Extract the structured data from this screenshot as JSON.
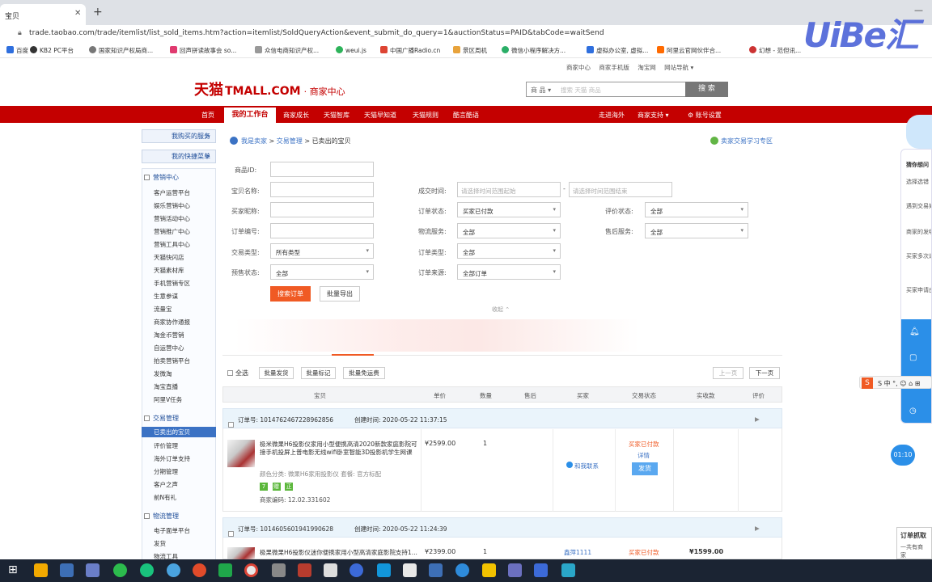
{
  "browser": {
    "tab_title": "宝贝",
    "new_tab": "+",
    "window_controls": "—",
    "url": "trade.taobao.com/trade/itemlist/list_sold_items.htm?action=itemlist/SoldQueryAction&event_submit_do_query=1&auctionStatus=PAID&tabCode=waitSend",
    "bookmarks": [
      "百度",
      "KB2 PC平台",
      "国家知识产权局商...",
      "回声拼读故事会 so...",
      "众信电商知识产权...",
      "weui.js",
      "中国广播Radio.cn",
      "景区周机",
      "微信小程序解决方...",
      "虚拟办公室, 虚拟...",
      "阿里云官网伙伴合...",
      "幻想 - 范但讯..."
    ],
    "watermark": "UiBe汇"
  },
  "site": {
    "top_links": [
      "商家中心",
      "商家手机版",
      "淘宝网",
      "网站导航 ▾"
    ],
    "logo_cn": "天猫",
    "logo_en": "TMALL.COM",
    "logo_suffix": "· 商家中心",
    "search_category": "商 品 ▾",
    "search_placeholder": "搜索 天猫 商品",
    "search_button": "搜 索",
    "nav": [
      "首页",
      "我的工作台",
      "商家成长",
      "天猫智库",
      "天猫早知道",
      "天猫规则",
      "酷言酷语"
    ],
    "nav_right": [
      "走进海外",
      "商家支持 ▾",
      "⚙ 账号设置"
    ]
  },
  "sidebar": {
    "btn_services": "我购买的服务",
    "btn_shortcuts": "我的快捷菜单",
    "arrow": ">",
    "sec_marketing": "营销中心",
    "marketing_items": [
      "客户运营平台",
      "娱乐营销中心",
      "营销活动中心",
      "营销推广中心",
      "营销工具中心",
      "天猫快闪店",
      "天猫素材库",
      "手机营销专区",
      "生意参谋",
      "流量宝",
      "商家协作通报",
      "淘金币营销",
      "自运营中心",
      "拍卖营销平台",
      "发微淘",
      "淘宝直播",
      "阿里V任务"
    ],
    "sec_trade": "交易管理",
    "trade_items": [
      "已卖出的宝贝",
      "评价管理",
      "海外订单支持",
      "分期管理",
      "客户之声",
      "前N有礼"
    ],
    "sec_logistics": "物流管理",
    "logistics_items": [
      "电子面单平台",
      "发货",
      "物流工具"
    ]
  },
  "breadcrumb": {
    "home": "我是卖家",
    "sep": ">",
    "trade": "交易管理",
    "current": "已卖出的宝贝"
  },
  "learn_link": "卖家交易学习专区",
  "filters": {
    "product_id": "商品ID:",
    "item_name": "宝贝名称:",
    "buyer_nick": "买家昵称:",
    "order_no": "订单编号:",
    "trade_type": "交易类型:",
    "presale_status": "预售状态:",
    "deal_time": "成交时间:",
    "time_start_ph": "请选择时间范围起始",
    "time_end_ph": "请选择时间范围结束",
    "order_status": "订单状态:",
    "order_status_val": "买家已付款",
    "logistics_service": "物流服务:",
    "logistics_val": "全部",
    "order_type": "订单类型:",
    "order_type_val": "全部",
    "order_source": "订单来源:",
    "order_source_val": "全部订单",
    "review_status": "评价状态:",
    "review_val": "全部",
    "after_sale": "售后服务:",
    "after_sale_val": "全部",
    "trade_type_val": "所有类型",
    "presale_val": "全部",
    "search_btn": "搜索订单",
    "export_btn": "批量导出",
    "collapse": "收起 ⌃"
  },
  "toolbar": {
    "select_all": "全选",
    "batch_ship": "批量发货",
    "batch_mark": "批量标记",
    "free_shipping": "批量免运费",
    "prev": "上一页",
    "next": "下一页"
  },
  "table_headers": [
    "宝贝",
    "单价",
    "数量",
    "售后",
    "买家",
    "交易状态",
    "实收款",
    "评价"
  ],
  "orders": [
    {
      "order_no": "订单号: 1014762467228962856",
      "created": "创建时间: 2020-05-22 11:37:15",
      "title": "极米微果H6投影仪家用小型便携高清2020新款家庭影院可接手机投屏上普电影无线wifi卧室智能3D投影机学生网课",
      "color": "颜色分类: 微果H6家用投影仪   套餐: 官方标配",
      "merchant_code": "商家编码: 12.02.331602",
      "price": "¥2599.00",
      "qty": "1",
      "buyer_contact": "和我联系",
      "status": "买家已付款",
      "detail": "详情",
      "ship_btn": "发货",
      "badges": [
        "7",
        "赠",
        "正"
      ]
    },
    {
      "order_no": "订单号: 1014605601941990628",
      "created": "创建时间: 2020-05-22 11:24:39",
      "title": "极果微果H6投影仪迷你便携家用小型高清家庭影院支持1...",
      "price": "¥2399.00",
      "qty": "1",
      "buyer": "鑫萍1111",
      "status": "买家已付款",
      "received": "¥1599.00"
    }
  ],
  "right_panel": {
    "questions": [
      "猜你想问",
      "选择选错",
      "遇到交易如何处理",
      "商家的发哪里修改",
      "买家多次退款却一怎么办?",
      "买家申请由退换货承担?"
    ],
    "timer": "01:10",
    "tip_title": "订单抓取",
    "tip_sub": "一共有商家"
  },
  "ime": "S 中 °, ☺ ⌂ ⊞"
}
